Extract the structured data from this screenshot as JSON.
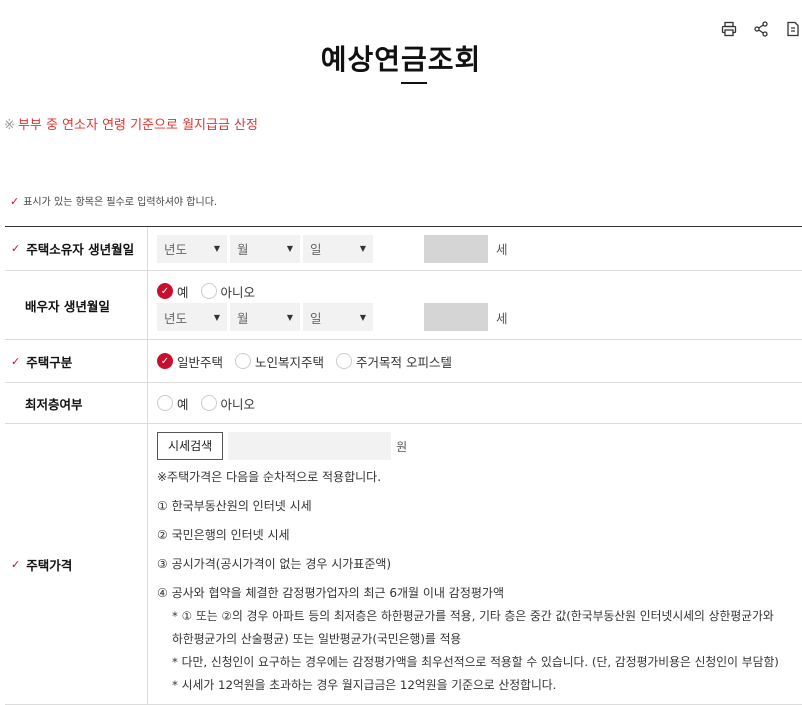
{
  "page": {
    "title": "예상연금조회"
  },
  "notice": {
    "mark": "※",
    "text": "부부 중 연소자 연령 기준으로 월지급금 산정"
  },
  "required_note": "표시가 있는 항목은 필수로 입력하셔야 합니다.",
  "form": {
    "owner_birth": {
      "label": "주택소유자 생년월일",
      "year_placeholder": "년도",
      "month_placeholder": "월",
      "day_placeholder": "일",
      "age_unit": "세"
    },
    "spouse_birth": {
      "label": "배우자 생년월일",
      "option_yes": "예",
      "option_no": "아니오",
      "selected": "예",
      "year_placeholder": "년도",
      "month_placeholder": "월",
      "day_placeholder": "일",
      "age_unit": "세"
    },
    "house_type": {
      "label": "주택구분",
      "options": [
        "일반주택",
        "노인복지주택",
        "주거목적 오피스텔"
      ],
      "selected": "일반주택"
    },
    "top_floor": {
      "label": "최저층여부",
      "option_yes": "예",
      "option_no": "아니오"
    },
    "house_price": {
      "label": "주택가격",
      "search_button": "시세검색",
      "unit": "원",
      "note_title": "※주택가격은 다음을 순차적으로 적용합니다.",
      "items": [
        "① 한국부동산원의 인터넷 시세",
        "② 국민은행의 인터넷 시세",
        "③ 공시가격(공시가격이 없는 경우 시가표준액)",
        "④ 공사와 협약을 체결한 감정평가업자의 최근 6개월 이내 감정평가액"
      ],
      "notes": [
        "* ① 또는 ②의 경우 아파트 등의 최저층은 하한평균가를 적용, 기타 층은 중간 값(한국부동산원 인터넷시세의 상한평균가와",
        "하한평균가의 산술평균) 또는 일반평균가(국민은행)를 적용",
        "* 다만, 신청인이 요구하는 경우에는 감정평가액을 최우선적으로 적용할 수 있습니다. (단, 감정평가비용은 신청인이 부담함)",
        "* 시세가 12억원을 초과하는 경우 월지급금은 12억원을 기준으로 산정합니다."
      ]
    }
  },
  "colors": {
    "accent": "#c8102e",
    "notice": "#e0342f"
  },
  "icons": [
    "print-icon",
    "share-icon",
    "bookmark-icon"
  ]
}
